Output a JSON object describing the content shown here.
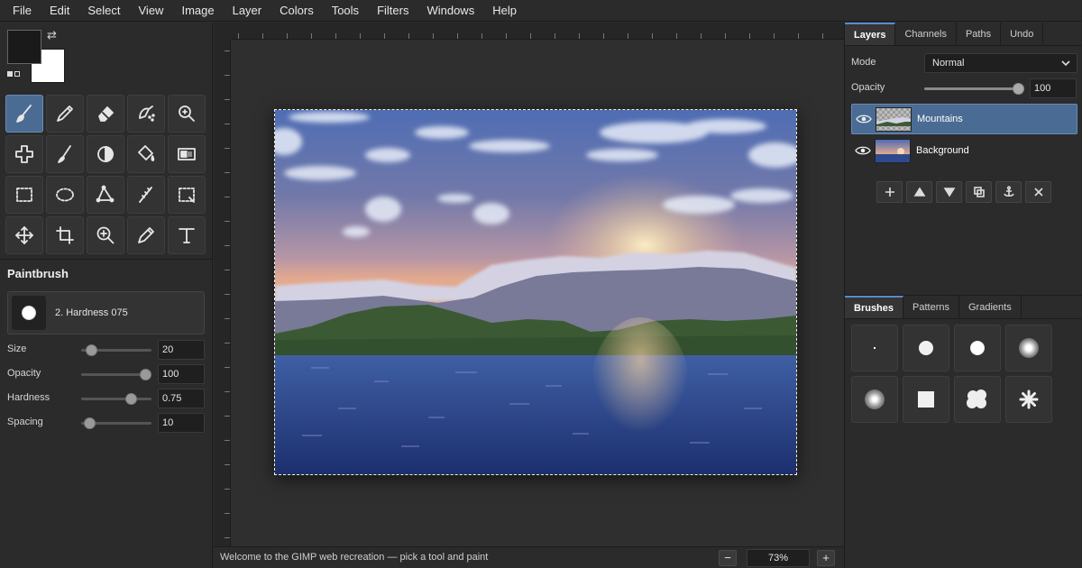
{
  "menubar": [
    "File",
    "Edit",
    "Select",
    "View",
    "Image",
    "Layer",
    "Colors",
    "Tools",
    "Filters",
    "Windows",
    "Help"
  ],
  "colors": {
    "foreground": "#1a1a1a",
    "background": "#ffffff",
    "accent": "#4a6b93"
  },
  "toolbox": {
    "tools": [
      {
        "icon": "paintbrush-icon",
        "active": true
      },
      {
        "icon": "pencil-icon"
      },
      {
        "icon": "eraser-icon"
      },
      {
        "icon": "airbrush-icon"
      },
      {
        "icon": "zoom-tool-icon"
      },
      {
        "icon": "heal-icon"
      },
      {
        "icon": "smudge-icon"
      },
      {
        "icon": "dodge-burn-icon"
      },
      {
        "icon": "bucket-fill-icon"
      },
      {
        "icon": "gradient-icon"
      },
      {
        "icon": "rect-select-icon"
      },
      {
        "icon": "ellipse-select-icon"
      },
      {
        "icon": "free-select-icon"
      },
      {
        "icon": "fuzzy-select-icon"
      },
      {
        "icon": "crop-select-icon"
      },
      {
        "icon": "move-icon"
      },
      {
        "icon": "crop-icon"
      },
      {
        "icon": "magnify-icon"
      },
      {
        "icon": "paths-icon"
      },
      {
        "icon": "text-icon"
      }
    ]
  },
  "tool_options": {
    "title": "Paintbrush",
    "brush_name": "2. Hardness 075",
    "options": [
      {
        "label": "Size",
        "value": "20",
        "fraction": 0.13
      },
      {
        "label": "Opacity",
        "value": "100",
        "fraction": 1.0
      },
      {
        "label": "Hardness",
        "value": "0.75",
        "fraction": 0.75
      },
      {
        "label": "Spacing",
        "value": "10",
        "fraction": 0.1
      }
    ]
  },
  "statusbar": {
    "message": "Welcome to the GIMP web recreation — pick a tool and paint",
    "zoom_minus": "−",
    "zoom_plus": "+",
    "zoom": "73%"
  },
  "layers_panel": {
    "tabs": [
      "Layers",
      "Channels",
      "Paths",
      "Undo"
    ],
    "mode_label": "Mode",
    "mode_value": "Normal",
    "opacity_label": "Opacity",
    "opacity_value": "100",
    "opacity_fraction": 1.0,
    "layers": [
      {
        "name": "Mountains",
        "selected": true,
        "visible": true
      },
      {
        "name": "Background",
        "selected": false,
        "visible": true
      }
    ],
    "actions": [
      "new-layer-icon",
      "raise-layer-icon",
      "lower-layer-icon",
      "duplicate-layer-icon",
      "anchor-icon",
      "delete-layer-icon"
    ]
  },
  "brushes_panel": {
    "tabs": [
      "Brushes",
      "Patterns",
      "Gradients"
    ],
    "brushes": [
      "pixel-brush",
      "hard-small-brush",
      "hard-medium-brush",
      "soft-brush",
      "fuzzy-brush",
      "square-brush",
      "cloud-brush",
      "star-brush"
    ]
  }
}
